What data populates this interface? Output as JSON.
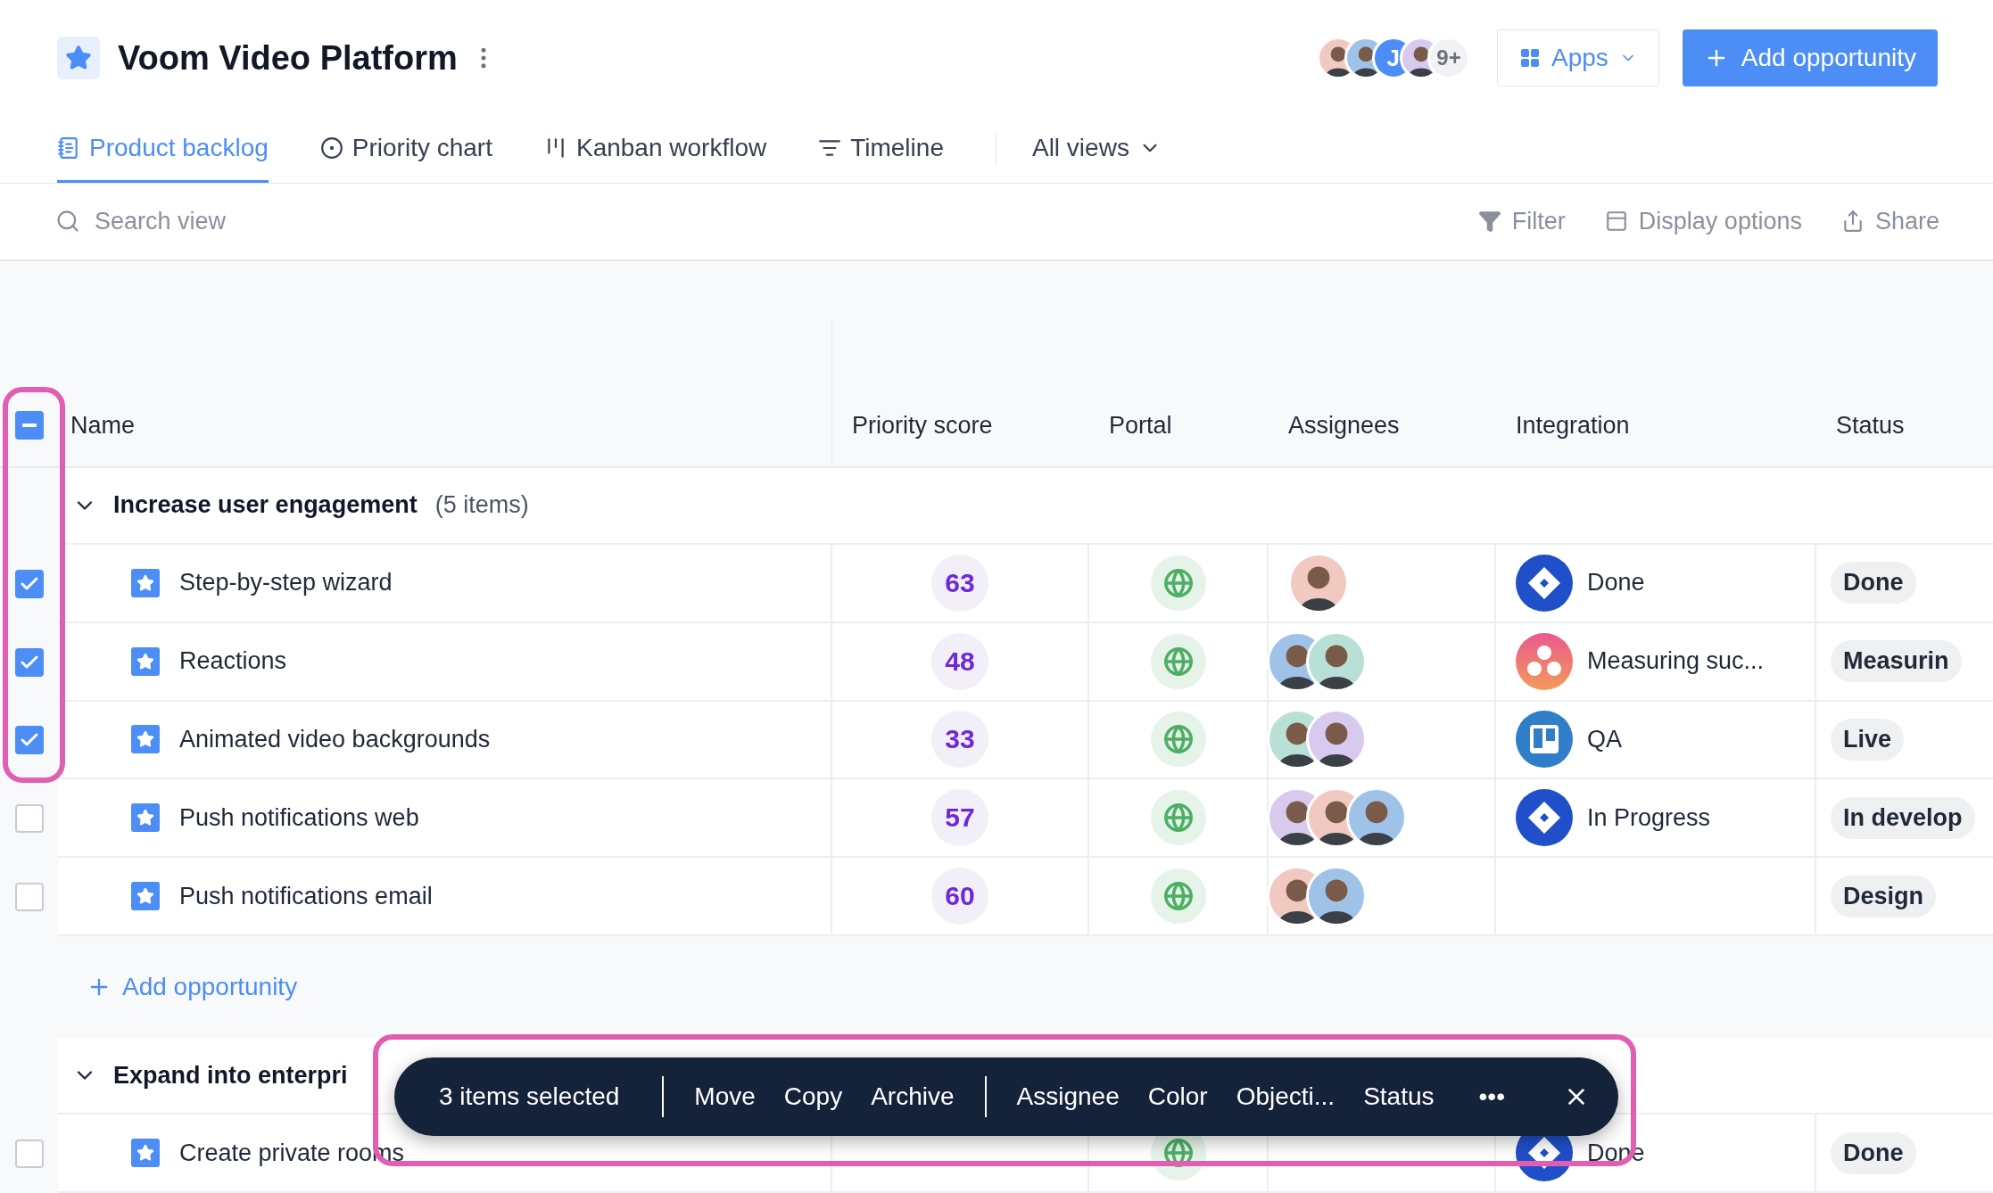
{
  "header": {
    "title": "Voom Video Platform",
    "members": [
      {
        "kind": "avatar"
      },
      {
        "kind": "avatar"
      },
      {
        "kind": "initial",
        "initial": "J"
      },
      {
        "kind": "avatar"
      }
    ],
    "more_members": "9+",
    "apps_button": "Apps",
    "add_button": "Add opportunity"
  },
  "tabs": [
    {
      "label": "Product backlog",
      "selected": true
    },
    {
      "label": "Priority chart",
      "selected": false
    },
    {
      "label": "Kanban workflow",
      "selected": false
    },
    {
      "label": "Timeline",
      "selected": false
    }
  ],
  "views_menu": "All views",
  "view_bar": {
    "search_placeholder": "Search view",
    "actions": [
      {
        "kind": "filter",
        "label": "Filter"
      },
      {
        "kind": "display",
        "label": "Display options"
      },
      {
        "kind": "share",
        "label": "Share"
      }
    ]
  },
  "table": {
    "select_all_partial": true,
    "columns": [
      "Name",
      "Priority score",
      "Portal",
      "Assignees",
      "Integration",
      "Status"
    ],
    "groups": [
      {
        "title": "Increase user engagement",
        "count": "(5 items)",
        "expanded": true,
        "add_label": "Add opportunity",
        "rows": [
          {
            "name": "Step-by-step wizard",
            "checked": true,
            "priority": "63",
            "portal": true,
            "assignees": [
              {
                "kind": "avatar"
              }
            ],
            "integration": {
              "kind": "diamond",
              "label": "Done"
            },
            "status": "Done"
          },
          {
            "name": "Reactions",
            "checked": true,
            "priority": "48",
            "portal": true,
            "assignees": [
              {
                "kind": "avatar"
              },
              {
                "kind": "avatar"
              }
            ],
            "integration": {
              "kind": "dots",
              "label": "Measuring suc..."
            },
            "status": "Measurin"
          },
          {
            "name": "Animated video backgrounds",
            "checked": true,
            "priority": "33",
            "portal": true,
            "assignees": [
              {
                "kind": "avatar"
              },
              {
                "kind": "avatar"
              }
            ],
            "integration": {
              "kind": "board",
              "label": "QA"
            },
            "status": "Live"
          },
          {
            "name": "Push notifications web",
            "checked": false,
            "priority": "57",
            "portal": true,
            "assignees": [
              {
                "kind": "avatar"
              },
              {
                "kind": "avatar"
              },
              {
                "kind": "avatar"
              }
            ],
            "integration": {
              "kind": "diamond",
              "label": "In Progress"
            },
            "status": "In develop"
          },
          {
            "name": "Push notifications email",
            "checked": false,
            "priority": "60",
            "portal": true,
            "assignees": [
              {
                "kind": "avatar"
              },
              {
                "kind": "avatar"
              }
            ],
            "status": "Design"
          }
        ]
      },
      {
        "title": "Expand into enterpri",
        "expanded": true,
        "rows": [
          {
            "name": "Create private rooms",
            "checked": false,
            "portal": true,
            "assignees": [],
            "integration": {
              "kind": "diamond",
              "label": "Done"
            },
            "status": "Done"
          }
        ]
      }
    ]
  },
  "selection_bar": {
    "count": "3 items selected",
    "action_groups": [
      [
        "Move",
        "Copy",
        "Archive"
      ],
      [
        "Assignee",
        "Color",
        "Objecti...",
        "Status"
      ]
    ],
    "more": "•••"
  }
}
